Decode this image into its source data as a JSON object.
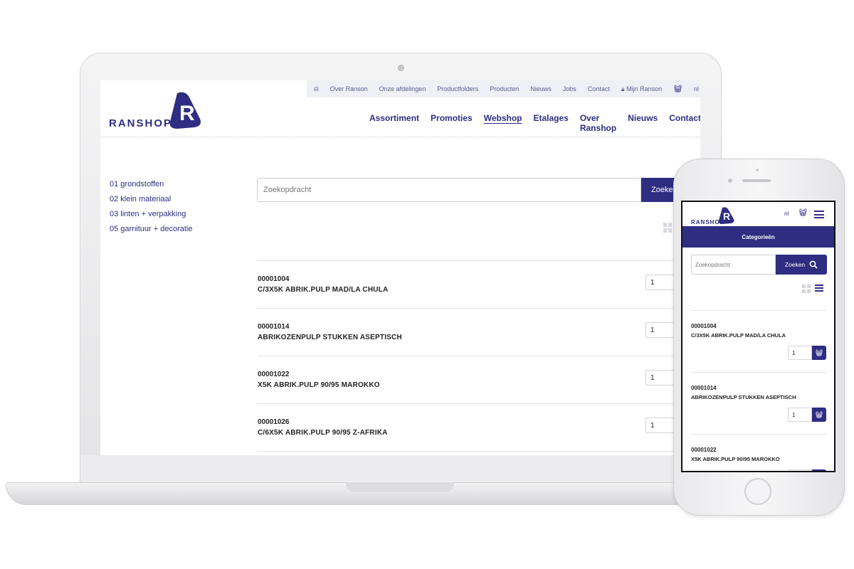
{
  "desktop": {
    "brand": "RANSHOP",
    "utility_nav": [
      "Over Ranson",
      "Onze afdelingen",
      "Productfolders",
      "Producten",
      "Nieuws",
      "Jobs",
      "Contact"
    ],
    "account_label": "Mijn Ranson",
    "lang": "nl",
    "main_nav": [
      "Assortiment",
      "Promoties",
      "Webshop",
      "Etalages",
      "Over Ranshop",
      "Nieuws",
      "Contact"
    ],
    "active_nav": "Webshop",
    "categories": [
      "01 grondstoffen",
      "02 klein materiaal",
      "03 linten + verpakking",
      "05 garnituur + decoratie"
    ],
    "search": {
      "placeholder": "Zoekopdracht",
      "button": "Zoeken"
    },
    "products": [
      {
        "code": "00001004",
        "name": "C/3X5K ABRIK.PULP MAD/LA CHULA",
        "qty": "1"
      },
      {
        "code": "00001014",
        "name": "ABRIKOZENPULP STUKKEN ASEPTISCH",
        "qty": "1"
      },
      {
        "code": "00001022",
        "name": "X5K ABRIK.PULP 90/95 MAROKKO",
        "qty": "1"
      },
      {
        "code": "00001026",
        "name": "C/6X5K ABRIK.PULP 90/95 Z-AFRIKA",
        "qty": "1"
      }
    ]
  },
  "mobile": {
    "brand": "RANSHOP",
    "lang": "nl",
    "categories_button": "Categorieën",
    "search": {
      "placeholder": "Zoekopdracht",
      "button": "Zoeken"
    },
    "products": [
      {
        "code": "00001004",
        "name": "C/3X5K ABRIK.PULP MAD/LA CHULA",
        "qty": "1"
      },
      {
        "code": "00001014",
        "name": "ABRIKOZENPULP STUKKEN ASEPTISCH",
        "qty": "1"
      },
      {
        "code": "00001022",
        "name": "X5K ABRIK.PULP 90/95 MAROKKO",
        "qty": ""
      }
    ]
  },
  "colors": {
    "brand": "#2e2d82",
    "util_bar": "#eef0f6",
    "border": "#e4e4e9"
  },
  "icons": [
    "bell-icon",
    "lock-icon",
    "basket-icon",
    "search-icon",
    "grid-view-icon",
    "list-view-icon",
    "menu-icon"
  ]
}
